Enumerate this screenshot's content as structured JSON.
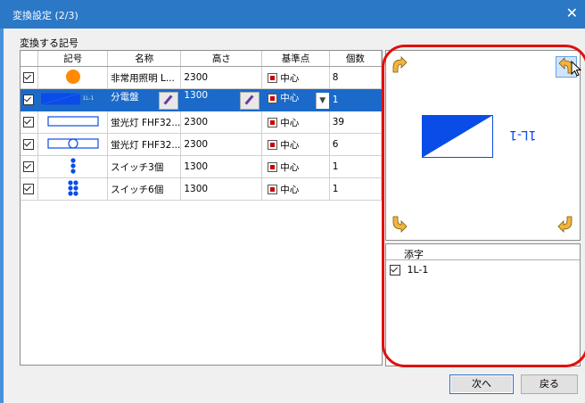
{
  "window": {
    "title": "変換設定 (2/3)",
    "close_glyph": "✕"
  },
  "section_label": "変換する記号",
  "table": {
    "columns": [
      "",
      "記号",
      "名称",
      "高さ",
      "基準点",
      "個数"
    ],
    "rows": [
      {
        "checked": true,
        "symbol": "orange-circle-icon",
        "name": "非常用照明 L...",
        "height": "2300",
        "base": "中心",
        "count": "8",
        "selected": false
      },
      {
        "checked": true,
        "symbol": "distribution-board-icon",
        "symbol_text": "1L-1",
        "name": "分電盤",
        "height": "1300",
        "base": "中心",
        "count": "1",
        "selected": true
      },
      {
        "checked": true,
        "symbol": "fluorescent-rect-icon",
        "name": "蛍光灯 FHF32...",
        "height": "2300",
        "base": "中心",
        "count": "39",
        "selected": false
      },
      {
        "checked": true,
        "symbol": "fluorescent-circle-icon",
        "name": "蛍光灯 FHF32...",
        "height": "2300",
        "base": "中心",
        "count": "6",
        "selected": false
      },
      {
        "checked": true,
        "symbol": "switch-3-icon",
        "name": "スイッチ3個",
        "height": "1300",
        "base": "中心",
        "count": "1",
        "selected": false
      },
      {
        "checked": true,
        "symbol": "switch-6-icon",
        "name": "スイッチ6個",
        "height": "1300",
        "base": "中心",
        "count": "1",
        "selected": false
      }
    ]
  },
  "preview": {
    "label_text": "1L-1"
  },
  "subscripts": {
    "header": "添字",
    "items": [
      {
        "checked": true,
        "label": "1L-1"
      }
    ]
  },
  "buttons": {
    "next": "次へ",
    "back": "戻る"
  },
  "colors": {
    "titlebar": "#2b78c7",
    "selection": "#1b6ac9",
    "highlight_ring": "#e01010",
    "symbol_blue": "#0a4ce8",
    "symbol_orange": "#ff8a00"
  }
}
